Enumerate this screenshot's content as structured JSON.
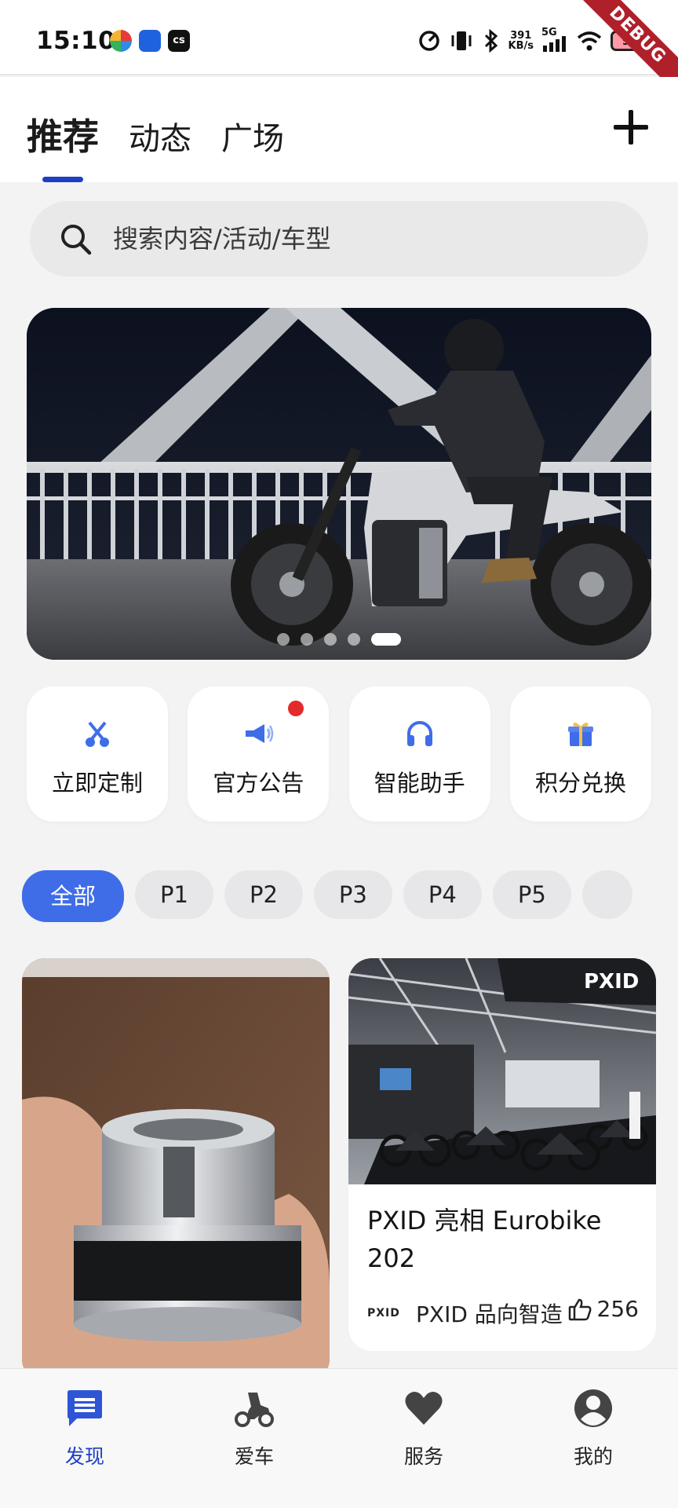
{
  "status_bar": {
    "time": "15:10",
    "net_speed_value": "391",
    "net_speed_unit": "KB/s",
    "signal_label": "5G",
    "battery": "95",
    "debug_label": "DEBUG",
    "icons": [
      "speedometer-icon",
      "vibrate-icon",
      "bluetooth-icon",
      "signal-icon",
      "wifi-icon",
      "battery-icon"
    ]
  },
  "header": {
    "tabs": [
      {
        "label": "推荐",
        "active": true
      },
      {
        "label": "动态",
        "active": false
      },
      {
        "label": "广场",
        "active": false
      }
    ]
  },
  "search": {
    "placeholder": "搜索内容/活动/车型"
  },
  "banner": {
    "page_count": 5,
    "active_index": 4
  },
  "quick_actions": [
    {
      "label": "立即定制",
      "icon": "scissors-icon",
      "badge": false
    },
    {
      "label": "官方公告",
      "icon": "megaphone-icon",
      "badge": true
    },
    {
      "label": "智能助手",
      "icon": "headphones-icon",
      "badge": false
    },
    {
      "label": "积分兑换",
      "icon": "gift-icon",
      "badge": false
    }
  ],
  "filters": [
    "全部",
    "P1",
    "P2",
    "P3",
    "P4",
    "P5",
    ""
  ],
  "feed": [
    {
      "title": "",
      "image": "metal-part-photo"
    },
    {
      "title": "PXID 亮相 Eurobike 202",
      "author_logo": "PXID",
      "author": "PXID 品向智造",
      "likes": "256",
      "image": "exhibition-booth-photo"
    }
  ],
  "bottom_nav": [
    {
      "label": "发现",
      "icon": "discover-icon",
      "active": true
    },
    {
      "label": "爱车",
      "icon": "scooter-icon",
      "active": false
    },
    {
      "label": "服务",
      "icon": "heart-icon",
      "active": false
    },
    {
      "label": "我的",
      "icon": "profile-icon",
      "active": false
    }
  ],
  "colors": {
    "accent": "#1d3fc4",
    "chip_active": "#3f6de8",
    "quick_icon": "#3f6de8",
    "badge": "#e22b2b"
  }
}
